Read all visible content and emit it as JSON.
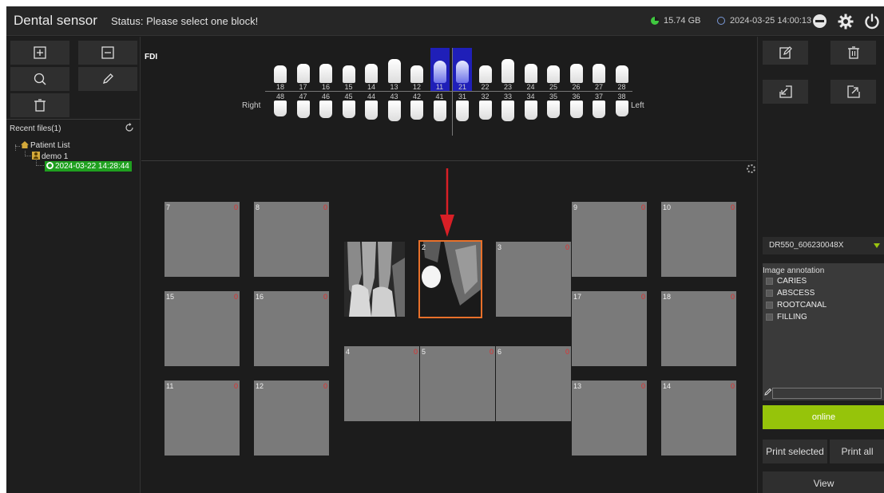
{
  "titlebar": {
    "app_title": "Dental sensor",
    "status": "Status: Please select one block!",
    "storage": "15.74 GB",
    "datetime": "2024-03-25 14:00:13"
  },
  "sidebar": {
    "recent_label": "Recent files(1)",
    "tree": {
      "root": "Patient List",
      "patient": "demo 1",
      "session": "2024-03-22 14:28:44"
    }
  },
  "tooth_chart": {
    "system_label": "FDI",
    "right_label": "Right",
    "left_label": "Left",
    "upper": [
      "18",
      "17",
      "16",
      "15",
      "14",
      "13",
      "12",
      "11",
      "21",
      "22",
      "23",
      "24",
      "25",
      "26",
      "27",
      "28"
    ],
    "lower": [
      "48",
      "47",
      "46",
      "45",
      "44",
      "43",
      "42",
      "41",
      "31",
      "32",
      "33",
      "34",
      "35",
      "36",
      "37",
      "38"
    ],
    "selected": [
      "11",
      "21"
    ]
  },
  "slots": [
    {
      "number": "7",
      "count": "0"
    },
    {
      "number": "8",
      "count": "0"
    },
    {
      "number": "9",
      "count": "0"
    },
    {
      "number": "10",
      "count": "0"
    },
    {
      "number": "",
      "count": ""
    },
    {
      "number": "2",
      "count": "0"
    },
    {
      "number": "3",
      "count": "0"
    },
    {
      "number": "15",
      "count": "0"
    },
    {
      "number": "16",
      "count": "0"
    },
    {
      "number": "17",
      "count": "0"
    },
    {
      "number": "18",
      "count": "0"
    },
    {
      "number": "4",
      "count": "0"
    },
    {
      "number": "5",
      "count": "0"
    },
    {
      "number": "6",
      "count": "0"
    },
    {
      "number": "11",
      "count": "0"
    },
    {
      "number": "12",
      "count": "0"
    },
    {
      "number": "13",
      "count": "0"
    },
    {
      "number": "14",
      "count": "0"
    }
  ],
  "right_panel": {
    "device": "DR550_606230048X",
    "annotation_title": "Image annotation",
    "annotations": [
      "CARIES",
      "ABSCESS",
      "ROOTCANAL",
      "FILLING"
    ],
    "online_label": "online",
    "print_selected": "Print selected",
    "print_all": "Print all",
    "view_label": "View"
  },
  "colors": {
    "accent_green": "#96c40a",
    "selected_tooth": "#1f1fb8",
    "active_slot": "#e8702a",
    "arrow": "#d81f26"
  },
  "icons": [
    "add-icon",
    "remove-icon",
    "search-icon",
    "pencil-icon",
    "delete-icon",
    "refresh-icon",
    "edit-icon",
    "trash-icon",
    "import-icon",
    "export-icon",
    "settings-icon",
    "power-icon",
    "minimize-icon"
  ]
}
